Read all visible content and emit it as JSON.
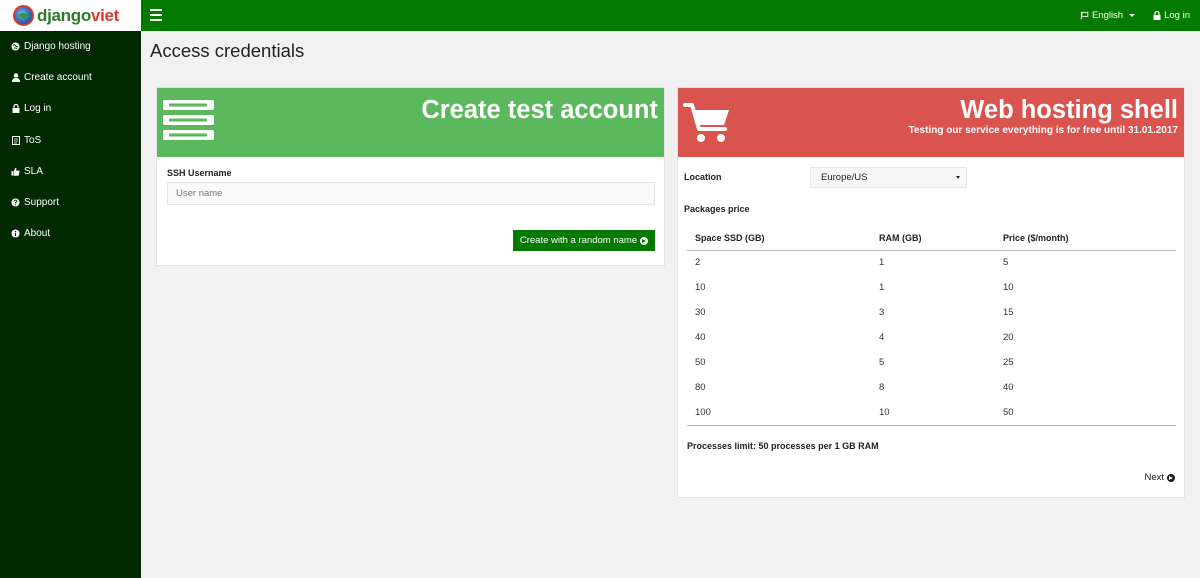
{
  "brand": {
    "text_part1": "django",
    "text_part2": "viet"
  },
  "navbar": {
    "language": "English",
    "login": "Log in"
  },
  "sidebar": {
    "items": [
      {
        "label": "Django hosting",
        "icon": "globe-icon"
      },
      {
        "label": "Create account",
        "icon": "user-icon"
      },
      {
        "label": "Log in",
        "icon": "lock-icon"
      },
      {
        "label": "ToS",
        "icon": "document-icon"
      },
      {
        "label": "SLA",
        "icon": "thumbs-up-icon"
      },
      {
        "label": "Support",
        "icon": "question-circle-icon"
      },
      {
        "label": "About",
        "icon": "info-circle-icon"
      }
    ]
  },
  "page": {
    "title": "Access credentials"
  },
  "create_panel": {
    "title": "Create test account",
    "ssh_label": "SSH Username",
    "username_placeholder": "User name",
    "button": "Create with a random name",
    "banner_color": "#5cb85c"
  },
  "hosting_panel": {
    "title": "Web hosting shell",
    "subtitle": "Testing our service everything is for free until 31.01.2017",
    "banner_color": "#d9534f",
    "location_label": "Location",
    "location_value": "Europe/US",
    "packages_label": "Packages price",
    "columns": [
      "Space SSD (GB)",
      "RAM (GB)",
      "Price ($/month)"
    ],
    "rows": [
      [
        "2",
        "1",
        "5"
      ],
      [
        "10",
        "1",
        "10"
      ],
      [
        "30",
        "3",
        "15"
      ],
      [
        "40",
        "4",
        "20"
      ],
      [
        "50",
        "5",
        "25"
      ],
      [
        "80",
        "8",
        "40"
      ],
      [
        "100",
        "10",
        "50"
      ]
    ],
    "limit_text": "Processes limit: 50 processes per 1 GB RAM",
    "next": "Next"
  },
  "colors": {
    "navbar": "#047a00",
    "sidebar": "#002900",
    "button": "#047a00"
  }
}
